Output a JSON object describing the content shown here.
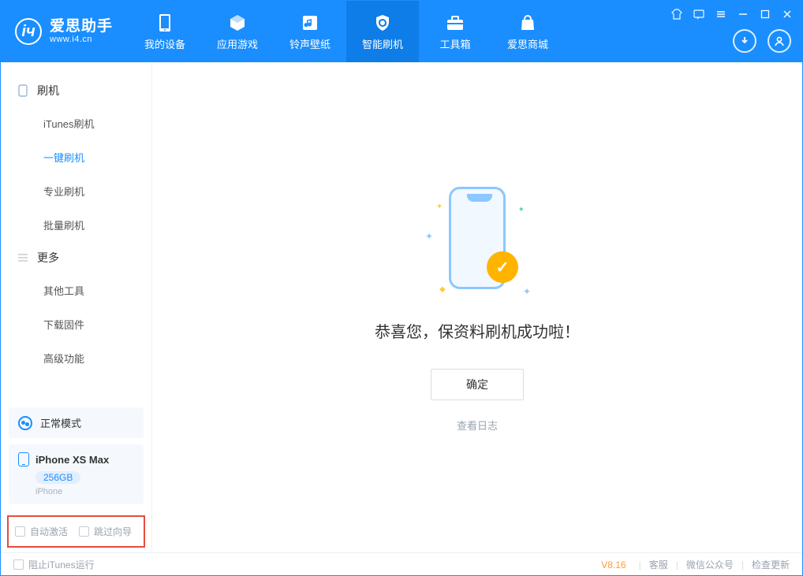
{
  "app": {
    "title": "爱思助手",
    "subtitle": "www.i4.cn"
  },
  "nav": {
    "items": [
      {
        "label": "我的设备"
      },
      {
        "label": "应用游戏"
      },
      {
        "label": "铃声壁纸"
      },
      {
        "label": "智能刷机"
      },
      {
        "label": "工具箱"
      },
      {
        "label": "爱思商城"
      }
    ]
  },
  "sidebar": {
    "group1_label": "刷机",
    "group1_items": [
      {
        "label": "iTunes刷机"
      },
      {
        "label": "一键刷机"
      },
      {
        "label": "专业刷机"
      },
      {
        "label": "批量刷机"
      }
    ],
    "group2_label": "更多",
    "group2_items": [
      {
        "label": "其他工具"
      },
      {
        "label": "下载固件"
      },
      {
        "label": "高级功能"
      }
    ],
    "mode_label": "正常模式",
    "device_name": "iPhone XS Max",
    "device_capacity": "256GB",
    "device_type": "iPhone",
    "checkbox1": "自动激活",
    "checkbox2": "跳过向导"
  },
  "main": {
    "message": "恭喜您，保资料刷机成功啦！",
    "ok_button": "确定",
    "log_link": "查看日志"
  },
  "footer": {
    "block_itunes": "阻止iTunes运行",
    "version": "V8.16",
    "link1": "客服",
    "link2": "微信公众号",
    "link3": "检查更新"
  }
}
